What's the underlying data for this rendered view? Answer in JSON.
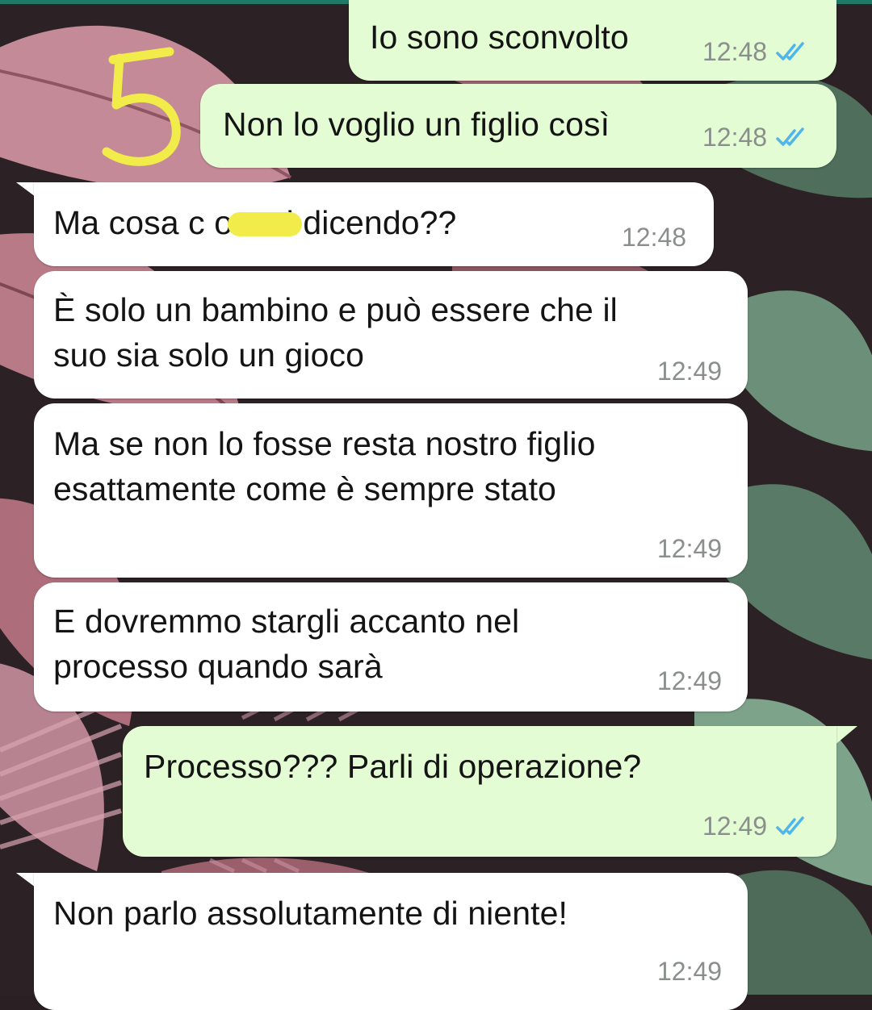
{
  "annotation": {
    "number_mark": "5"
  },
  "messages": [
    {
      "direction": "outgoing",
      "text": "Io sono sconvolto",
      "time": "12:48",
      "status": "read"
    },
    {
      "direction": "outgoing",
      "text": "Non lo voglio un figlio così",
      "time": "12:48",
      "status": "read"
    },
    {
      "direction": "incoming",
      "text": "Ma cosa c      o stai dicendo??",
      "time": "12:48",
      "redacted": true
    },
    {
      "direction": "incoming",
      "text": "È solo un bambino e può essere che il\nsuo sia solo un gioco",
      "time": "12:49"
    },
    {
      "direction": "incoming",
      "text": "Ma se non lo fosse resta nostro figlio\nesattamente come è sempre stato",
      "time": "12:49"
    },
    {
      "direction": "incoming",
      "text": "E dovremmo stargli accanto nel\nprocesso quando sarà",
      "time": "12:49"
    },
    {
      "direction": "outgoing",
      "text": "Processo??? Parli di operazione?",
      "time": "12:49",
      "status": "read"
    },
    {
      "direction": "incoming",
      "text": "Non parlo assolutamente di niente!",
      "time": "12:49"
    }
  ],
  "colors": {
    "outgoing_bubble": "#e3fcd3",
    "incoming_bubble": "#ffffff",
    "read_ticks": "#4fb6ec",
    "annotation_marker": "#f2ec4a"
  },
  "icons": {
    "read_receipt": "double-check-icon"
  }
}
